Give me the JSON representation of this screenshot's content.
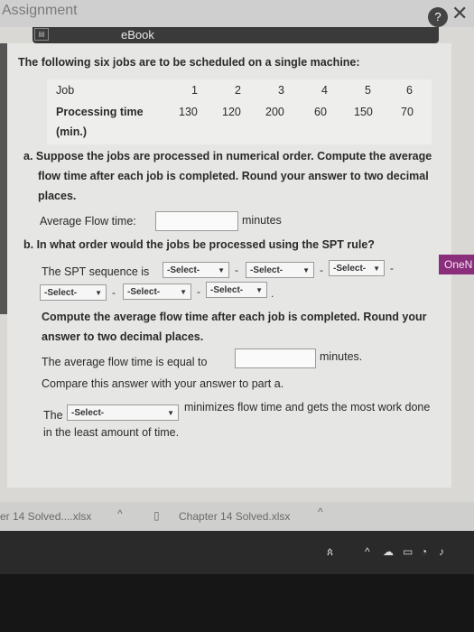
{
  "app": {
    "title": "Assignment",
    "help": "?",
    "close": "✕"
  },
  "ebook": {
    "label": "eBook"
  },
  "problem": {
    "intro": "The following six jobs are to be scheduled on a single machine:",
    "table": {
      "row1_label": "Job",
      "row2_label": "Processing time",
      "row2_unit": "(min.)",
      "jobs": [
        "1",
        "2",
        "3",
        "4",
        "5",
        "6"
      ],
      "times": [
        "130",
        "120",
        "200",
        "60",
        "150",
        "70"
      ]
    }
  },
  "part_a": {
    "line1": "a. Suppose the jobs are processed in numerical order. Compute the average",
    "line2": "flow time after each job is completed. Round your answer to two decimal",
    "line3": "places.",
    "label": "Average Flow time:",
    "value": "",
    "unit": "minutes"
  },
  "part_b": {
    "question": "b. In what order would the jobs be processed using the SPT rule?",
    "sequence_label": "The SPT sequence is",
    "select_text": "-Select-",
    "dash": "-",
    "period": ".",
    "compute_line1": "Compute the average flow time after each job is completed. Round your",
    "compute_line2": "answer to two decimal places.",
    "avg_label": "The average flow time is equal to",
    "avg_value": "",
    "avg_unit": "minutes.",
    "compare": "Compare this answer with your answer to part a.",
    "the": "The",
    "rule_select": "-Select-",
    "conclusion1": "minimizes flow time and gets the most work done",
    "conclusion2": "in the least amount of time."
  },
  "onenote": "OneN",
  "downloads": {
    "item1": "er 14 Solved....xlsx",
    "item2": "Chapter 14 Solved.xlsx"
  }
}
